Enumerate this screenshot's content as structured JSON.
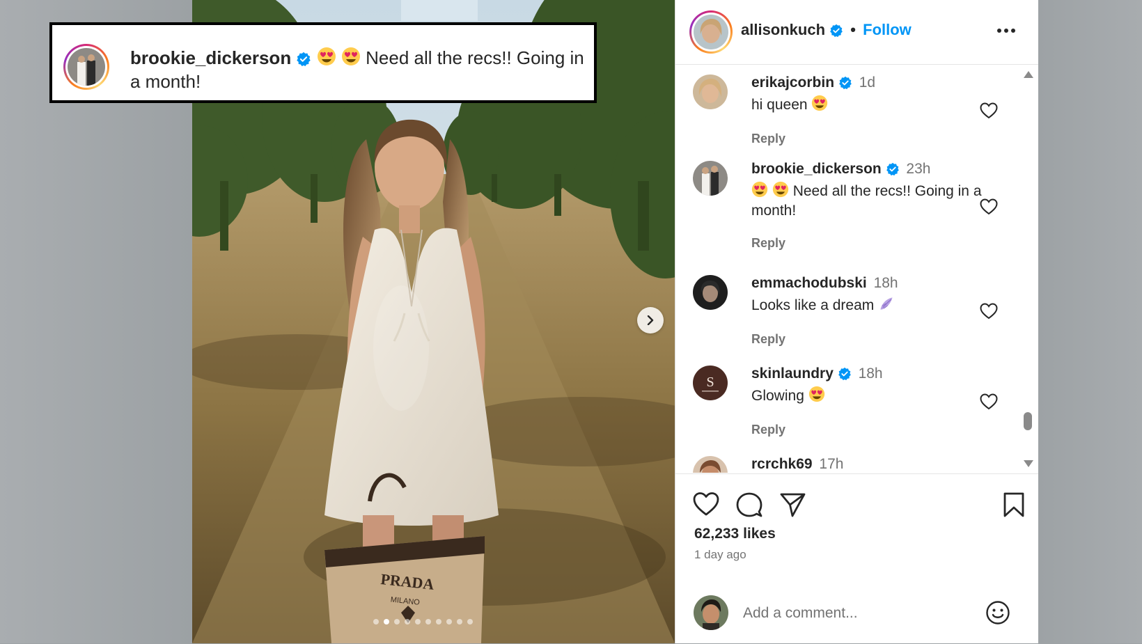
{
  "callout": {
    "username": "brookie_dickerson",
    "text": " Need all the recs!! Going in a month!"
  },
  "post": {
    "author": "allisonkuch",
    "follow_label": "Follow",
    "separator": "•",
    "likes": "62,233 likes",
    "time_ago": "1 day ago",
    "add_comment_placeholder": "Add a comment...",
    "carousel": {
      "count": 10,
      "active": 1
    }
  },
  "comments": [
    {
      "user": "erikajcorbin",
      "verified": true,
      "time": "1d",
      "text": "hi queen",
      "emoji_after": 1,
      "emoji_before": 0,
      "reply": "Reply"
    },
    {
      "user": "brookie_dickerson",
      "verified": true,
      "time": "23h",
      "text": "Need all the recs!! Going in a month!",
      "emoji_after": 0,
      "emoji_before": 2,
      "reply": "Reply"
    },
    {
      "user": "emmachodubski",
      "verified": false,
      "time": "18h",
      "text": "Looks like a dream",
      "emoji_after": 0,
      "emoji_before": 0,
      "reply": "Reply"
    },
    {
      "user": "skinlaundry",
      "verified": true,
      "time": "18h",
      "text": "Glowing",
      "emoji_after": 1,
      "emoji_before": 0,
      "reply": "Reply"
    },
    {
      "user": "rcrchk69",
      "verified": false,
      "time": "17h",
      "text": "",
      "emoji_after": 0,
      "emoji_before": 0,
      "reply": ""
    }
  ],
  "colors": {
    "verified": "#0095f6",
    "follow": "#0095f6",
    "text": "#262626",
    "muted": "#737373"
  },
  "icons": [
    "verified-badge-icon",
    "more-icon",
    "heart-icon",
    "comment-icon",
    "share-icon",
    "bookmark-icon",
    "smile-icon",
    "chevron-right-icon",
    "heart-eyes-emoji",
    "wing-emoji"
  ]
}
